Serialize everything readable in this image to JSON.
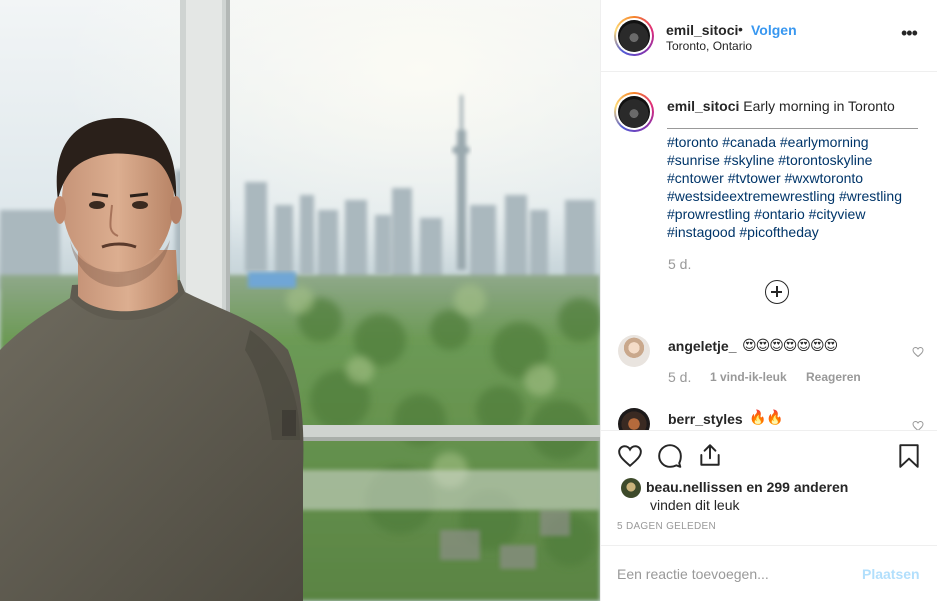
{
  "post": {
    "username": "emil_sitoci",
    "separator": "•",
    "follow_label": "Volgen",
    "location": "Toronto, Ontario",
    "more_label": "•••"
  },
  "caption": {
    "username": "emil_sitoci",
    "text": "Early morning in Toronto",
    "hashtags_lines": [
      "#toronto #canada #earlymorning",
      "#sunrise #skyline #torontoskyline",
      "#cntower #tvtower #wxwtoronto",
      "#westsideextremewrestling #wrestling",
      "#prowrestling #ontario #cityview",
      "#instagood #picoftheday"
    ],
    "time": "5 d."
  },
  "comments": [
    {
      "username": "angeletje_",
      "text": "😍😍😍😍😍😍😍",
      "time": "5 d.",
      "likes": "1 vind-ik-leuk",
      "reply_label": "Reageren"
    },
    {
      "username": "berr_styles",
      "text": "🔥🔥"
    }
  ],
  "likes": {
    "line1": "beau.nellissen en 299 anderen",
    "line2": "vinden dit leuk"
  },
  "date": "5 DAGEN GELEDEN",
  "add_comment": {
    "placeholder": "Een reactie toevoegen...",
    "post_label": "Plaatsen"
  },
  "icons": {
    "like": "heart-icon",
    "comment": "speech-bubble-icon",
    "share": "share-icon",
    "save": "bookmark-icon",
    "load_more": "plus-circle-icon",
    "options": "more-dots-icon"
  },
  "colors": {
    "link": "#3897f0",
    "hashtag": "#003569",
    "muted": "#999999",
    "post_disabled": "#b2dffc"
  }
}
